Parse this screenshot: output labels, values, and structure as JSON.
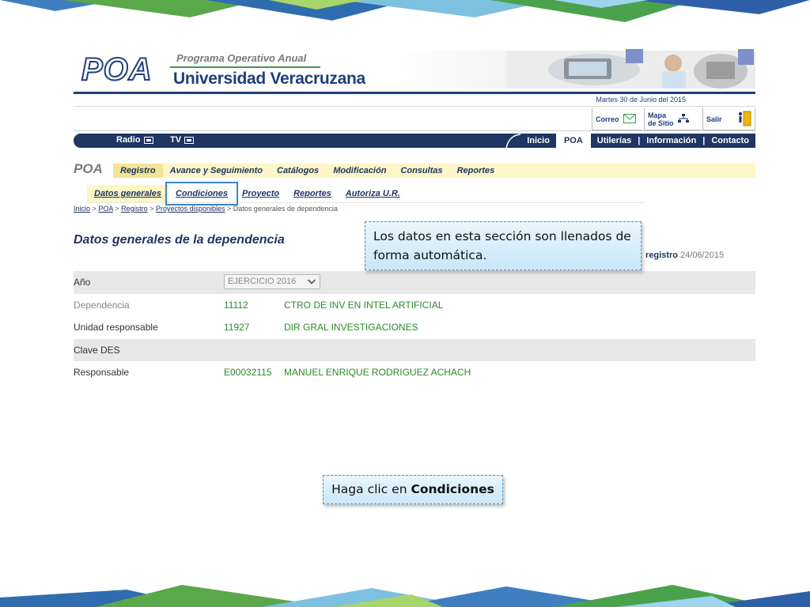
{
  "header": {
    "logo_text": "POA",
    "program_subtitle": "Programa Operativo Anual",
    "university_name": "Universidad Veracruzana",
    "date": "Martes 30 de Junio del 2015"
  },
  "utilities": {
    "correo": "Correo",
    "mapa_line1": "Mapa",
    "mapa_line2": "de Sitio",
    "salir": "Salir"
  },
  "navbar": {
    "radio": "Radio",
    "tv": "TV",
    "items": [
      "Inicio",
      "POA",
      "Utilerías",
      "Información",
      "Contacto"
    ],
    "active": "POA"
  },
  "menu": {
    "label": "POA",
    "items": [
      "Registro",
      "Avance y Seguimiento",
      "Catálogos",
      "Modificación",
      "Consultas",
      "Reportes"
    ]
  },
  "submenu": {
    "items": [
      "Datos generales",
      "Condiciones",
      "Proyecto",
      "Reportes",
      "Autoriza U.R."
    ]
  },
  "breadcrumb": {
    "items": [
      "Inicio",
      "POA",
      "Registro",
      "Proyectos disponibles"
    ],
    "current": "Datos generales de dependencia",
    "separator": ">"
  },
  "section": {
    "title": "Datos generales de la dependencia",
    "registro_label": "registro",
    "registro_date": "24/06/2015"
  },
  "table": {
    "anio_label": "Año",
    "anio_value": "EJERCICIO 2016",
    "dependencia_label": "Dependencia",
    "dependencia_code": "11112",
    "dependencia_desc": "CTRO DE INV EN INTEL ARTIFICIAL",
    "unidad_label": "Unidad responsable",
    "unidad_code": "11927",
    "unidad_desc": "DIR GRAL INVESTIGACIONES",
    "clave_label": "Clave DES",
    "responsable_label": "Responsable",
    "responsable_code": "E00032115",
    "responsable_desc": "MANUEL ENRIQUE  RODRIGUEZ ACHACH"
  },
  "callouts": {
    "top": "Los datos en esta sección son llenados de forma automática.",
    "bottom_prefix": "Haga clic en ",
    "bottom_bold": "Condiciones"
  },
  "colors": {
    "navy": "#1f3562",
    "green_text": "#2a8a2a",
    "menu_bg": "#fdf6c7",
    "callout_border": "#5b8fc2",
    "highlight": "#3a86c8"
  }
}
